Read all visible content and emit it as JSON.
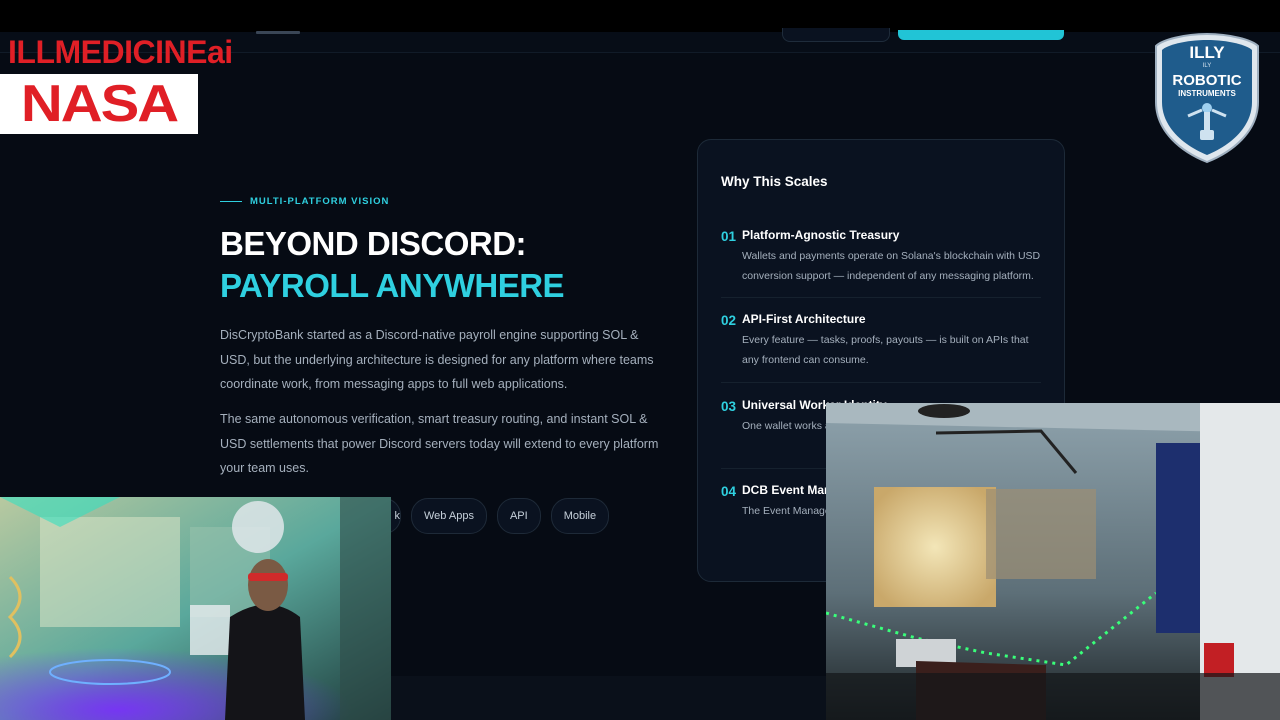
{
  "overlay": {
    "brand_text": "ILLMEDICINEai",
    "nasa_logo_text": "NASA",
    "badge": {
      "line1": "ILLY",
      "line2": "ROBOTIC",
      "line3": "INSTRUMENTS",
      "small": "ILY"
    }
  },
  "section": {
    "tag": "MULTI-PLATFORM VISION",
    "headline_1": "BEYOND DISCORD:",
    "headline_2": "PAYROLL ANYWHERE",
    "paragraph_1": "DisCryptoBank started as a Discord-native payroll engine supporting SOL & USD, but the underlying architecture is designed for any platform where teams coordinate work, from messaging apps to full web applications.",
    "paragraph_2": "The same autonomous verification, smart treasury routing, and instant SOL & USD settlements that power Discord servers today will extend to every platform your team uses.",
    "pills": [
      "k",
      "Web Apps",
      "API",
      "Mobile"
    ]
  },
  "panel": {
    "title": "Why This Scales",
    "features": [
      {
        "num": "01",
        "title": "Platform-Agnostic Treasury",
        "desc": "Wallets and payments operate on Solana's blockchain with USD conversion support — independent of any messaging platform."
      },
      {
        "num": "02",
        "title": "API-First Architecture",
        "desc": "Every feature — tasks, proofs, payouts — is built on APIs that any frontend can consume."
      },
      {
        "num": "03",
        "title": "Universal Worker Identity",
        "desc": "One wallet works a need separate acc"
      },
      {
        "num": "04",
        "title": "DCB Event Mana",
        "desc": "The Event Manage standalone web ap"
      }
    ]
  },
  "colors": {
    "accent": "#2fd0e0",
    "background": "#060b14",
    "brand_red": "#e01f26"
  }
}
